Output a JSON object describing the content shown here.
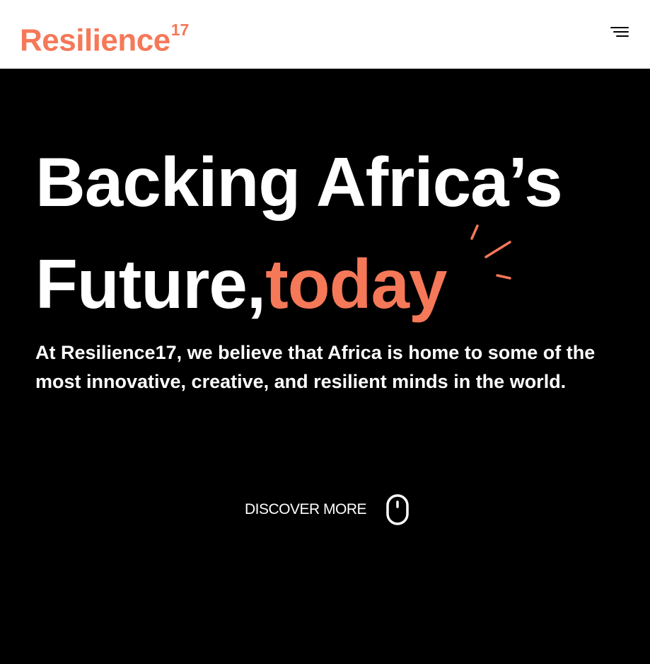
{
  "header": {
    "logo_text": "Resilience",
    "logo_superscript": "17",
    "menu_icon": "hamburger-menu-icon"
  },
  "hero": {
    "headline_line1": "Backing Africa’s",
    "headline_line2_prefix": "Future,",
    "headline_accent": "today",
    "intro": "At Resilience17, we believe that Africa is home to some of the most innovative, creative, and resilient minds in the world.",
    "cta_label": "DISCOVER MORE",
    "cta_icon": "mouse-scroll-icon",
    "accent_decoration_icon": "spark-lines-icon"
  },
  "colors": {
    "accent": "#f57858",
    "background": "#000000",
    "header_background": "#ffffff",
    "text": "#ffffff"
  }
}
